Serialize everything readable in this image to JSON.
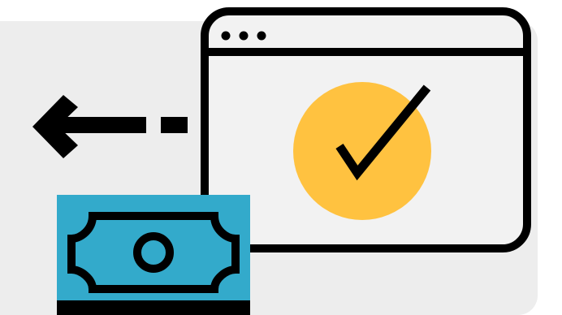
{
  "colors": {
    "background": "#ffffff",
    "panel": "#ededed",
    "window_fill": "#f2f2f2",
    "outline": "#000000",
    "check_circle": "#ffc240",
    "banknote": "#33aacb"
  },
  "icons": {
    "window": "browser-window-icon",
    "status": "checkmark-icon",
    "direction": "arrow-left-icon",
    "payment": "banknote-icon"
  }
}
